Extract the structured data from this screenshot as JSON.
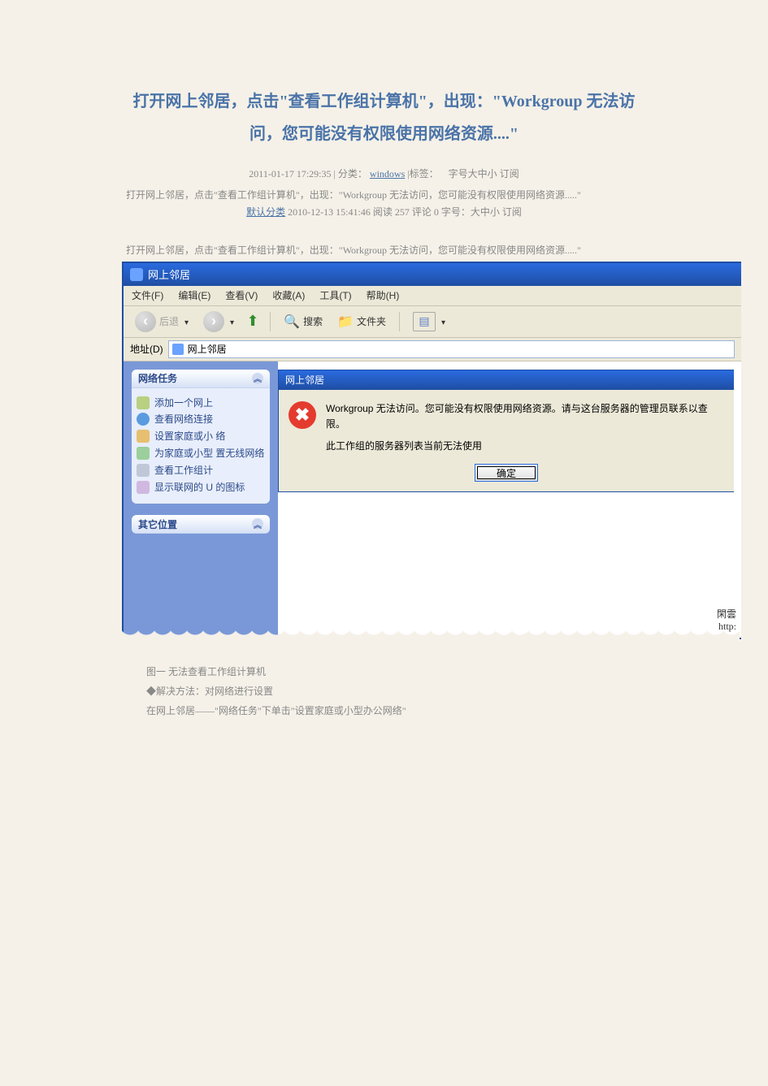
{
  "post": {
    "title": "打开网上邻居，点击\"查看工作组计算机\"，出现：\"Workgroup 无法访问，您可能没有权限使用网络资源....\"",
    "meta_date": "2011-01-17 17:29:35",
    "meta_sep": "|",
    "meta_cat_label": "分类：",
    "meta_cat_link": "windows",
    "meta_tag_label": "|标签：",
    "meta_font_label": "字号大中小",
    "meta_sub": "订阅",
    "intro_line1": "打开网上邻居，点击\"查看工作组计算机\"，出现：\"Workgroup 无法访问，您可能没有权限使用网络资源.....\"",
    "default_cat": "默认分类",
    "intro_line2_rest": " 2010-12-13 15:41:46  阅读 257  评论 0   字号：大中小 订阅",
    "body_line": "打开网上邻居，点击\"查看工作组计算机\"，出现：\"Workgroup 无法访问，您可能没有权限使用网络资源.....\""
  },
  "xp": {
    "title": "网上邻居",
    "menu": {
      "file": "文件(F)",
      "edit": "编辑(E)",
      "view": "查看(V)",
      "fav": "收藏(A)",
      "tools": "工具(T)",
      "help": "帮助(H)"
    },
    "toolbar": {
      "back": "后退",
      "search": "搜索",
      "folders": "文件夹"
    },
    "address": {
      "label": "地址(D)",
      "value": "网上邻居"
    },
    "sidebar": {
      "panel1_title": "网络任务",
      "tasks": [
        "添加一个网上",
        "查看网络连接",
        "设置家庭或小  络",
        "为家庭或小型  置无线网络",
        "查看工作组计",
        "显示联网的 U  的图标"
      ],
      "panel2_title": "其它位置"
    },
    "dialog": {
      "title": "网上邻居",
      "msg1": "Workgroup 无法访问。您可能没有权限使用网络资源。请与这台服务器的管理员联系以查  限。",
      "msg2": "此工作组的服务器列表当前无法使用",
      "ok": "确定"
    },
    "watermark_top": "閑雲",
    "watermark_url": "http:"
  },
  "caption": {
    "line1": "图一    无法查看工作组计算机",
    "line2": "◆解决方法：对网络进行设置",
    "line3": "在网上邻居——\"网络任务\"下单击\"设置家庭或小型办公网络\""
  }
}
